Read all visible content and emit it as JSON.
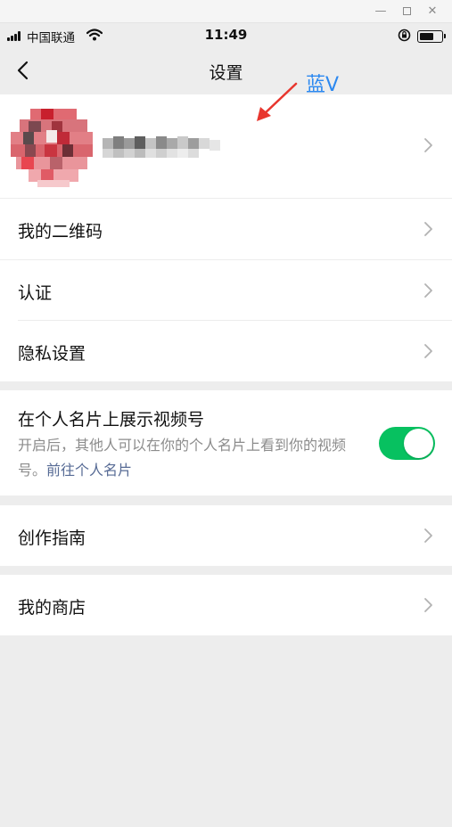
{
  "window": {
    "minimize": "—",
    "close": "✕"
  },
  "status_bar": {
    "carrier": "中国联通",
    "time": "11:49"
  },
  "nav": {
    "title": "设置"
  },
  "annotation": {
    "text": "蓝V",
    "color": "#2d89f0"
  },
  "menu": {
    "qr_code": "我的二维码",
    "verification": "认证",
    "privacy": "隐私设置",
    "guide": "创作指南",
    "store": "我的商店"
  },
  "card_toggle": {
    "title": "在个人名片上展示视频号",
    "description": "开启后，其他人可以在你的个人名片上看到你的视频号。",
    "link": "前往个人名片",
    "enabled": true
  },
  "colors": {
    "accent": "#07c160",
    "link": "#576b95",
    "background": "#ededed"
  },
  "icons": [
    "signal-icon",
    "wifi-icon",
    "orientation-lock-icon",
    "battery-icon",
    "back-arrow-icon",
    "chevron-right-icon"
  ]
}
